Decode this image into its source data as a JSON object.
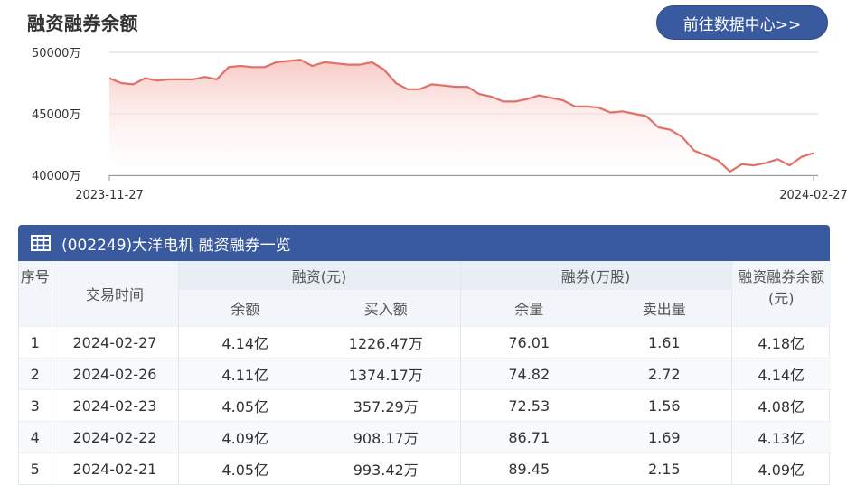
{
  "title": "融资融券余额",
  "nav_button": "前往数据中心>>",
  "table": {
    "title": "(002249)大洋电机 融资融券一览",
    "headers": {
      "index": "序号",
      "date": "交易时间",
      "financing": "融资(元)",
      "fin_balance": "余额",
      "fin_buy": "买入额",
      "securities": "融券(万股)",
      "sec_balance": "余量",
      "sec_sell": "卖出量",
      "total": "融资融券余额(元)"
    },
    "rows": [
      {
        "index": "1",
        "date": "2024-02-27",
        "fin_balance": "4.14亿",
        "fin_buy": "1226.47万",
        "sec_balance": "76.01",
        "sec_sell": "1.61",
        "total": "4.18亿"
      },
      {
        "index": "2",
        "date": "2024-02-26",
        "fin_balance": "4.11亿",
        "fin_buy": "1374.17万",
        "sec_balance": "74.82",
        "sec_sell": "2.72",
        "total": "4.14亿"
      },
      {
        "index": "3",
        "date": "2024-02-23",
        "fin_balance": "4.05亿",
        "fin_buy": "357.29万",
        "sec_balance": "72.53",
        "sec_sell": "1.56",
        "total": "4.08亿"
      },
      {
        "index": "4",
        "date": "2024-02-22",
        "fin_balance": "4.09亿",
        "fin_buy": "908.17万",
        "sec_balance": "86.71",
        "sec_sell": "1.69",
        "total": "4.13亿"
      },
      {
        "index": "5",
        "date": "2024-02-21",
        "fin_balance": "4.05亿",
        "fin_buy": "993.42万",
        "sec_balance": "89.45",
        "sec_sell": "2.15",
        "total": "4.09亿"
      }
    ]
  },
  "colors": {
    "line": "#e07068",
    "fill_top": "#f7c4bf",
    "accent": "#3a5aa0"
  },
  "chart_data": {
    "type": "area",
    "ylim": [
      40000,
      50000
    ],
    "yticks": [
      {
        "value": 40000,
        "label": "40000万"
      },
      {
        "value": 45000,
        "label": "45000万"
      },
      {
        "value": 50000,
        "label": "50000万"
      }
    ],
    "xtick_labels": [
      "2023-11-27",
      "2024-02-27"
    ],
    "grid": true,
    "series": [
      {
        "values": [
          47900,
          47500,
          47400,
          47900,
          47700,
          47800,
          47800,
          47800,
          48000,
          47800,
          48800,
          48900,
          48800,
          48800,
          49200,
          49300,
          49400,
          48900,
          49200,
          49100,
          49000,
          49000,
          49200,
          48600,
          47500,
          47000,
          47000,
          47400,
          47300,
          47200,
          47200,
          46600,
          46400,
          46000,
          46000,
          46200,
          46500,
          46300,
          46100,
          45600,
          45600,
          45500,
          45100,
          45200,
          45000,
          44800,
          43900,
          43700,
          43100,
          42000,
          41600,
          41200,
          40300,
          40900,
          40800,
          41000,
          41300,
          40800,
          41500,
          41800
        ]
      }
    ]
  }
}
